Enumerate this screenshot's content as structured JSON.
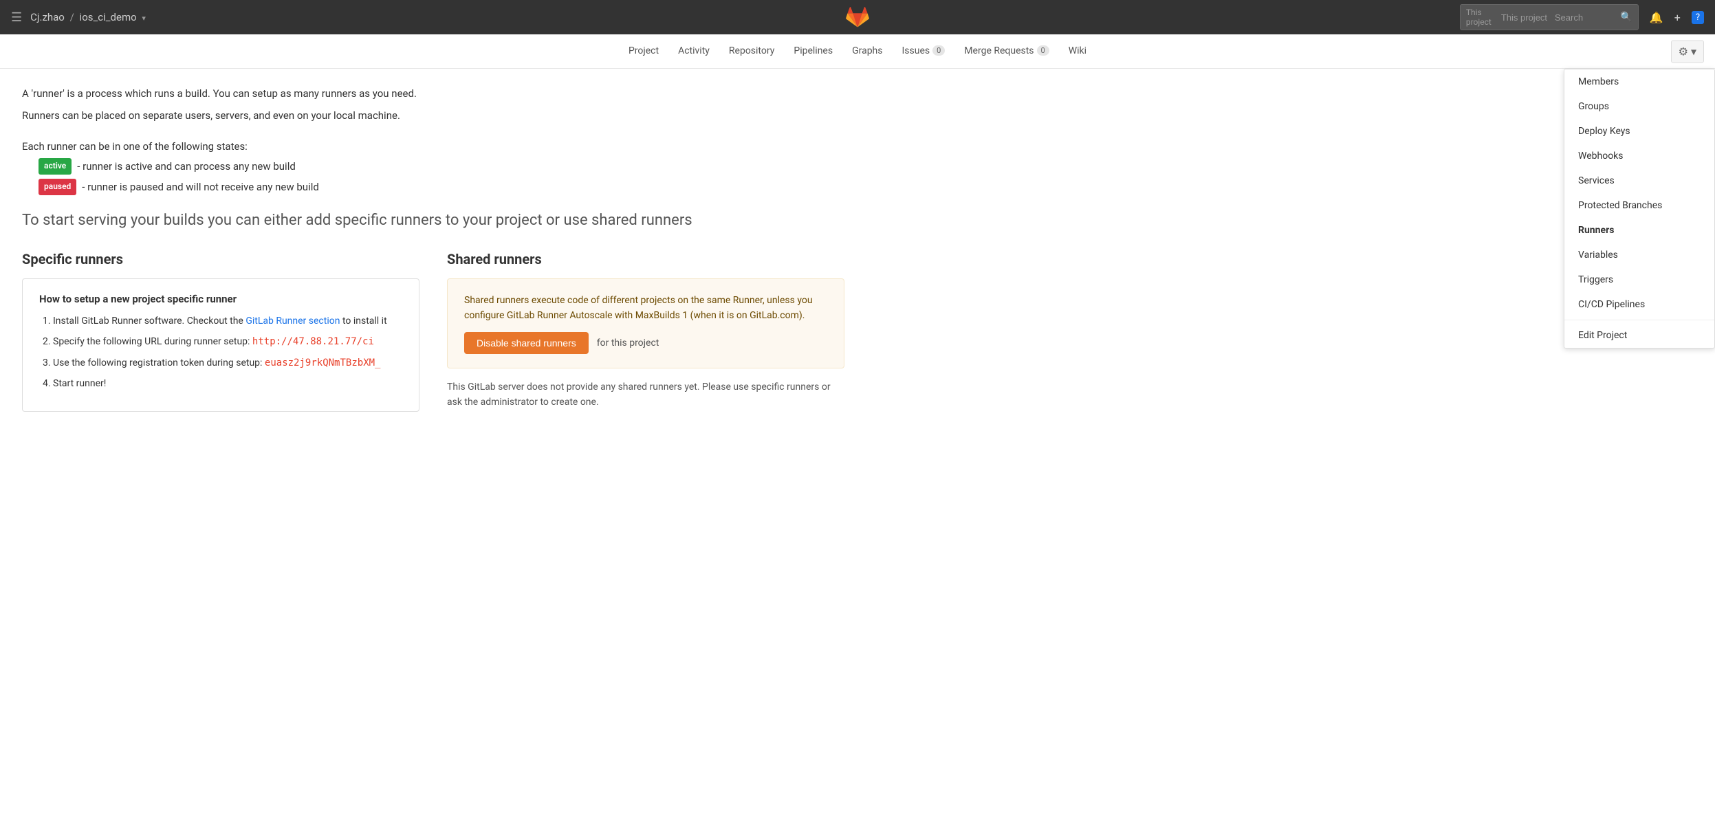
{
  "topbar": {
    "hamburger": "☰",
    "breadcrumb_user": "Cj.zhao",
    "breadcrumb_separator": "/",
    "breadcrumb_repo": "ios_ci_demo",
    "breadcrumb_dropdown": "▾",
    "search_placeholder": "This project   Search",
    "bell_icon": "🔔",
    "plus_icon": "+",
    "help_icon": "?"
  },
  "secondary_nav": {
    "links": [
      {
        "label": "Project",
        "badge": null
      },
      {
        "label": "Activity",
        "badge": null
      },
      {
        "label": "Repository",
        "badge": null
      },
      {
        "label": "Pipelines",
        "badge": null
      },
      {
        "label": "Graphs",
        "badge": null
      },
      {
        "label": "Issues",
        "badge": "0"
      },
      {
        "label": "Merge Requests",
        "badge": "0"
      },
      {
        "label": "Wiki",
        "badge": null
      }
    ],
    "settings_gear": "⚙"
  },
  "dropdown_menu": {
    "items": [
      {
        "label": "Members",
        "active": false
      },
      {
        "label": "Groups",
        "active": false
      },
      {
        "label": "Deploy Keys",
        "active": false
      },
      {
        "label": "Webhooks",
        "active": false
      },
      {
        "label": "Services",
        "active": false
      },
      {
        "label": "Protected Branches",
        "active": false
      },
      {
        "label": "Runners",
        "active": true
      },
      {
        "label": "Variables",
        "active": false
      },
      {
        "label": "Triggers",
        "active": false
      },
      {
        "label": "CI/CD Pipelines",
        "active": false
      }
    ],
    "divider_before": "Edit Project",
    "edit_project": "Edit Project"
  },
  "main": {
    "intro_line1": "A 'runner' is a process which runs a build. You can setup as many runners as you need.",
    "intro_line2": "Runners can be placed on separate users, servers, and even on your local machine.",
    "states_intro": "Each runner can be in one of the following states:",
    "badge_active": "active",
    "active_desc": "- runner is active and can process any new build",
    "badge_paused": "paused",
    "paused_desc": "- runner is paused and will not receive any new build",
    "cta": "To start serving your builds you can either add specific runners to your project or use shared runners",
    "specific_title": "Specific runners",
    "setup_box_title": "How to setup a new project specific runner",
    "step1": "Install GitLab Runner software. Checkout the ",
    "step1_link": "GitLab Runner section",
    "step1_end": " to install it",
    "step2_prefix": "Specify the following URL during runner setup: ",
    "step2_url": "http://47.88.21.77/ci",
    "step3_prefix": "Use the following registration token during setup: ",
    "step3_token": "euasz2j9rkQNmTBzbXM_",
    "step4": "Start runner!",
    "shared_title": "Shared runners",
    "shared_desc": "Shared runners execute code of different projects on the same Runner, unless you configure GitLab Runner Autoscale with MaxBuilds 1 (when it is on GitLab.com).",
    "disable_btn": "Disable shared runners",
    "disable_suffix": "for this project",
    "no_runners": "This GitLab server does not provide any shared runners yet. Please use specific runners or ask the administrator to create one."
  }
}
